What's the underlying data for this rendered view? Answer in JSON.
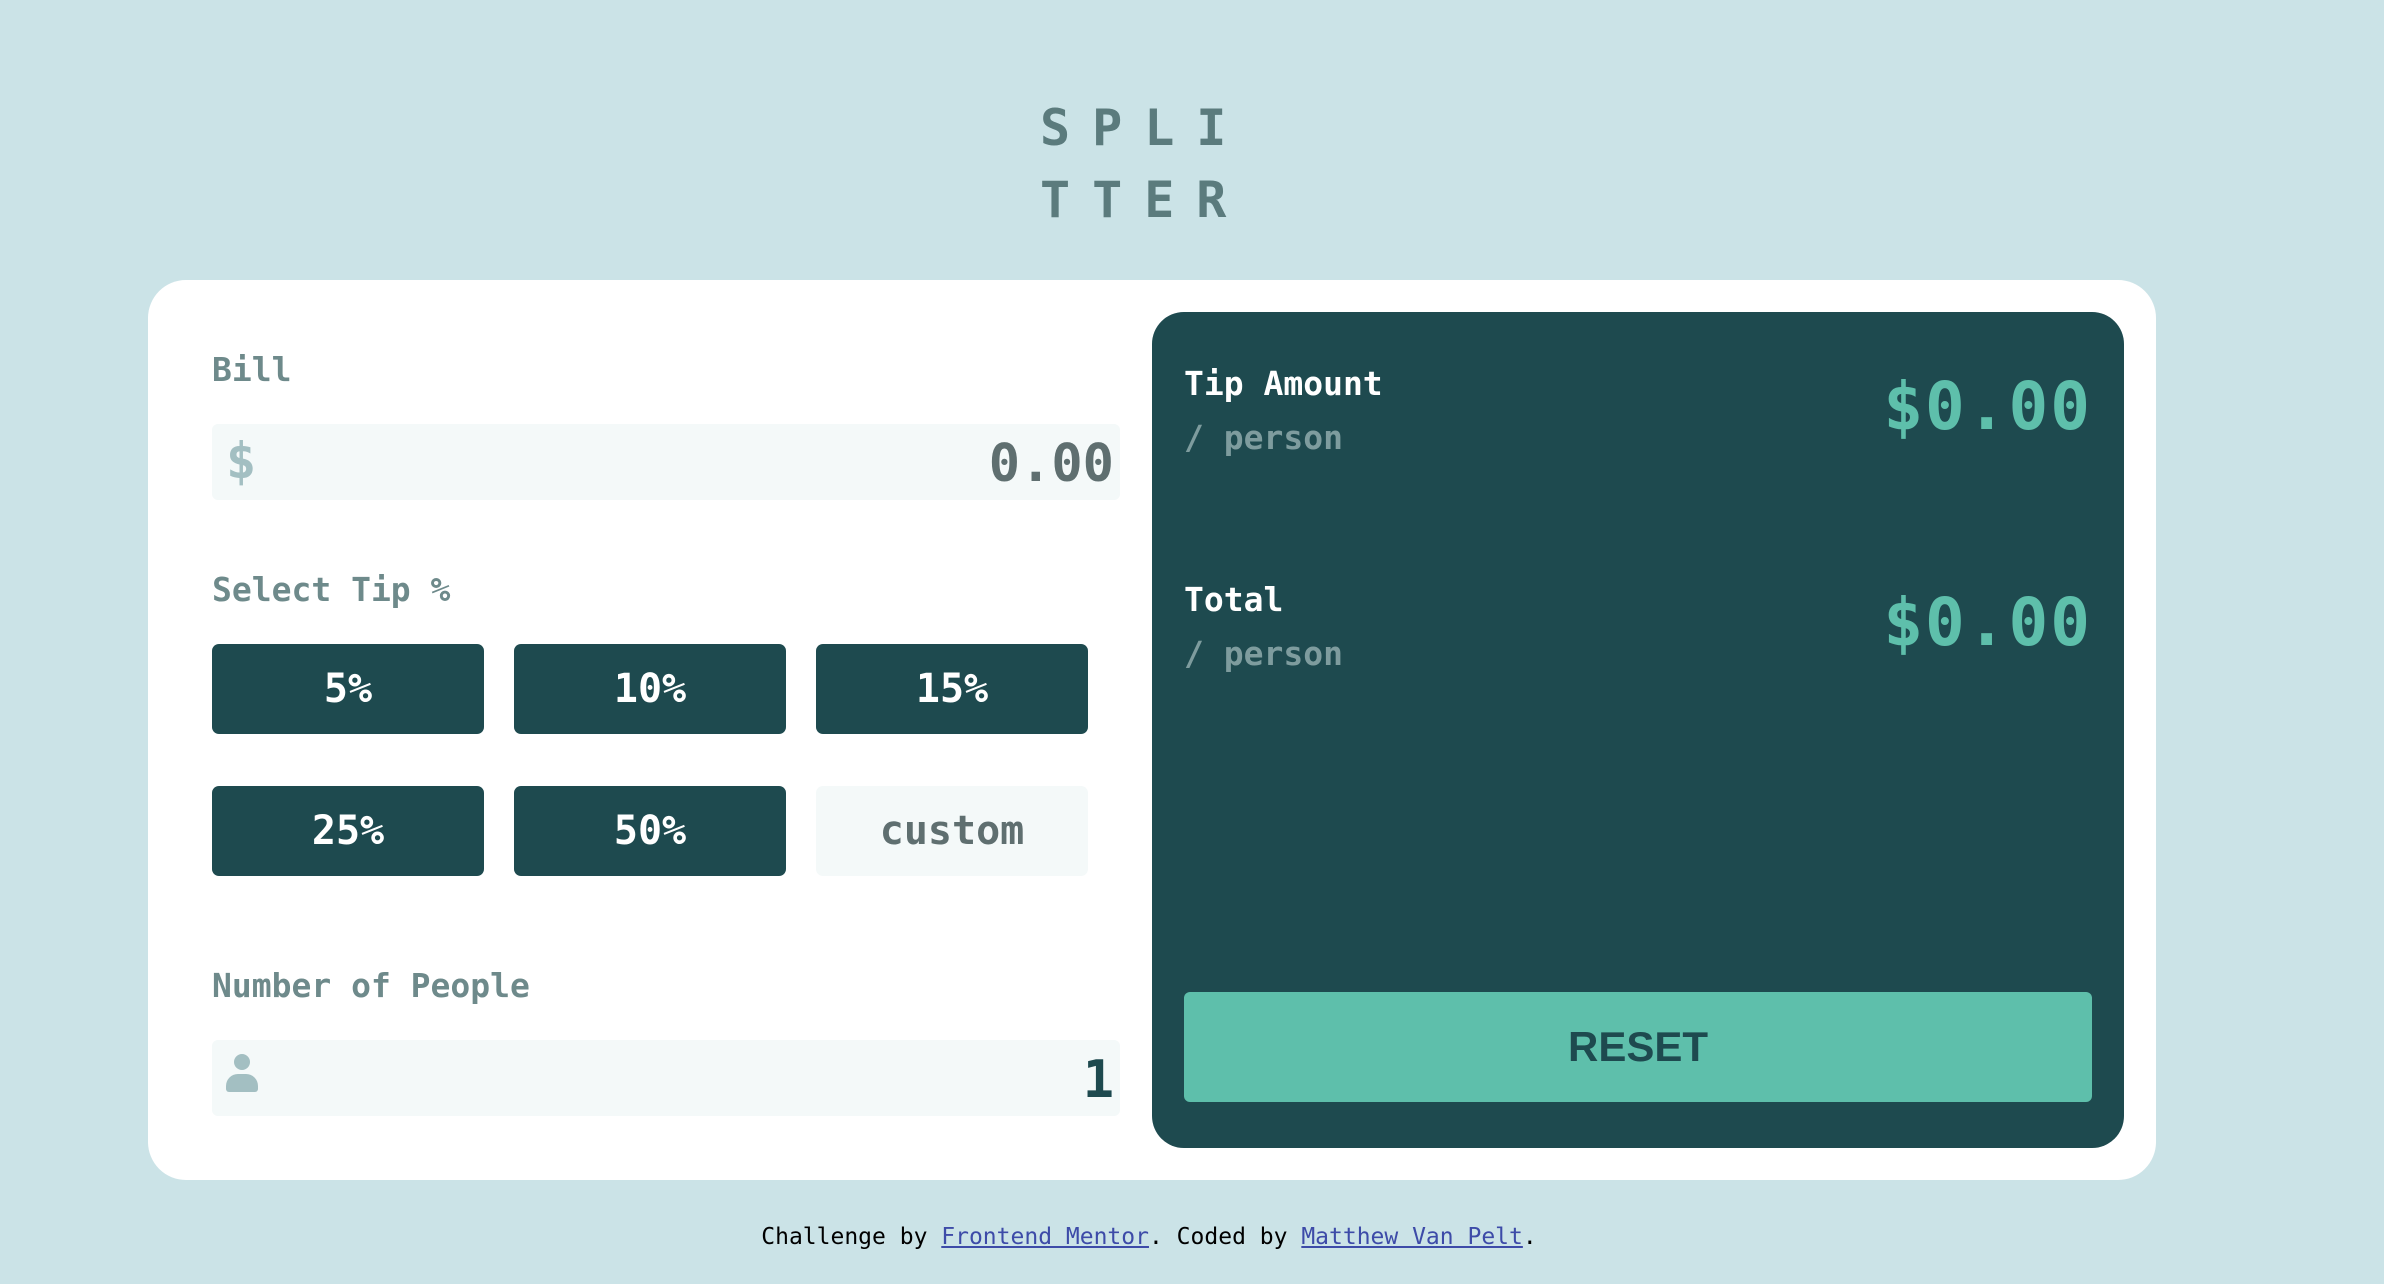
{
  "app": {
    "logo_line1": "SPLI",
    "logo_line2": "TTER"
  },
  "form": {
    "bill_label": "Bill",
    "bill_prefix": "$",
    "bill_value": "0.00",
    "tip_label": "Select Tip %",
    "tip_options": [
      "5%",
      "10%",
      "15%",
      "25%",
      "50%"
    ],
    "custom_label": "custom",
    "people_label": "Number of People",
    "people_value": "1"
  },
  "results": {
    "tip_title": "Tip Amount",
    "tip_sub": "/ person",
    "tip_amount": "$0.00",
    "total_title": "Total",
    "total_sub": "/ person",
    "total_amount": "$0.00",
    "reset_label": "RESET"
  },
  "footer": {
    "prefix": "Challenge by ",
    "link1": "Frontend Mentor",
    "middle": ". Coded by ",
    "link2": "Matthew Van Pelt",
    "suffix": "."
  },
  "colors": {
    "background": "#cbe3e7",
    "dark_teal": "#1e4a4f",
    "accent": "#5ebfab"
  }
}
